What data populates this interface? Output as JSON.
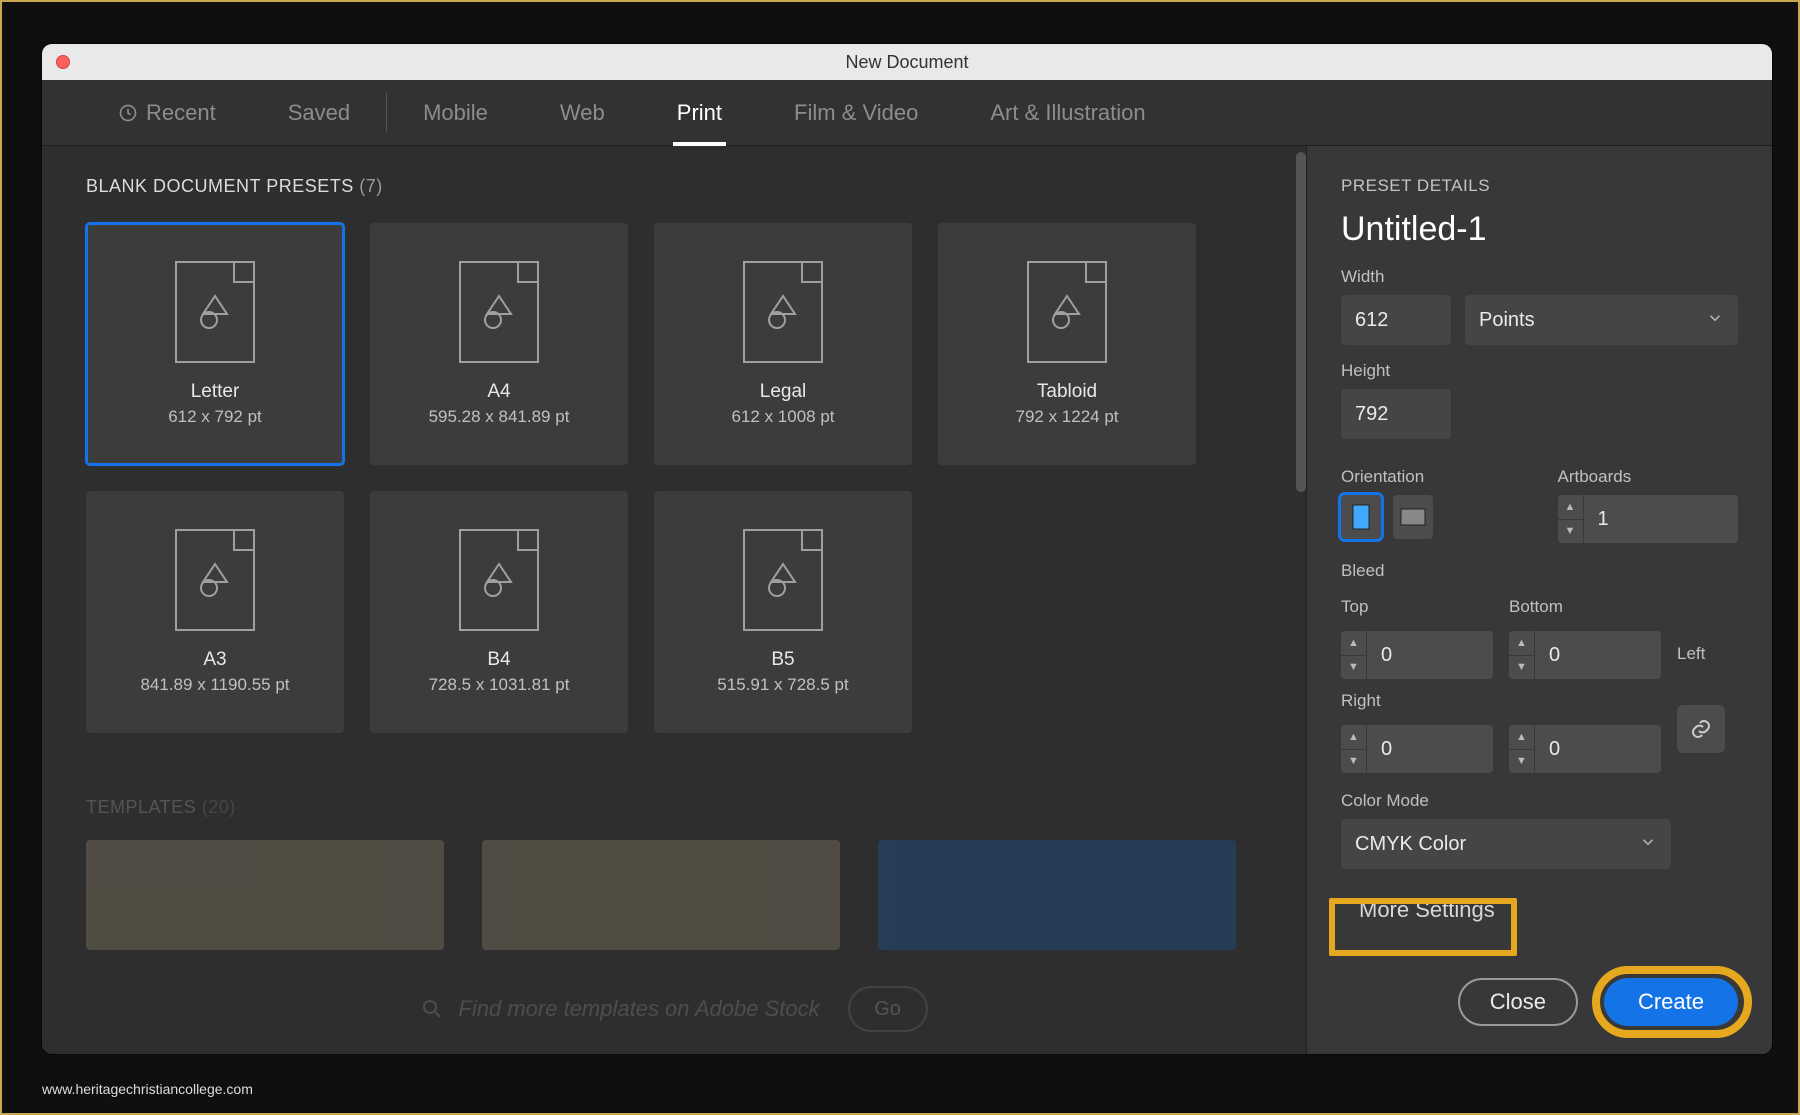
{
  "window": {
    "title": "New Document"
  },
  "tabs": {
    "recent": "Recent",
    "saved": "Saved",
    "mobile": "Mobile",
    "web": "Web",
    "print": "Print",
    "film": "Film & Video",
    "art": "Art & Illustration"
  },
  "presets_header": {
    "label": "BLANK DOCUMENT PRESETS",
    "count": "(7)"
  },
  "presets": [
    {
      "name": "Letter",
      "size": "612 x 792 pt"
    },
    {
      "name": "A4",
      "size": "595.28 x 841.89 pt"
    },
    {
      "name": "Legal",
      "size": "612 x 1008 pt"
    },
    {
      "name": "Tabloid",
      "size": "792 x 1224 pt"
    },
    {
      "name": "A3",
      "size": "841.89 x 1190.55 pt"
    },
    {
      "name": "B4",
      "size": "728.5 x 1031.81 pt"
    },
    {
      "name": "B5",
      "size": "515.91 x 728.5 pt"
    }
  ],
  "templates_header": {
    "label": "TEMPLATES",
    "count": "(20)"
  },
  "search": {
    "placeholder": "Find more templates on Adobe Stock",
    "go_label": "Go"
  },
  "details": {
    "section_label": "PRESET DETAILS",
    "doc_name": "Untitled-1",
    "width_label": "Width",
    "width_value": "612",
    "units_selected": "Points",
    "height_label": "Height",
    "height_value": "792",
    "orientation_label": "Orientation",
    "artboards_label": "Artboards",
    "artboards_value": "1",
    "bleed_label": "Bleed",
    "bleed_top_label": "Top",
    "bleed_bottom_label": "Bottom",
    "bleed_left_label": "Left",
    "bleed_right_label": "Right",
    "bleed_top": "0",
    "bleed_bottom": "0",
    "bleed_left": "0",
    "bleed_right": "0",
    "color_mode_label": "Color Mode",
    "color_mode_value": "CMYK Color",
    "more_settings": "More Settings"
  },
  "buttons": {
    "close": "Close",
    "create": "Create"
  },
  "watermark": "www.heritagechristiancollege.com"
}
